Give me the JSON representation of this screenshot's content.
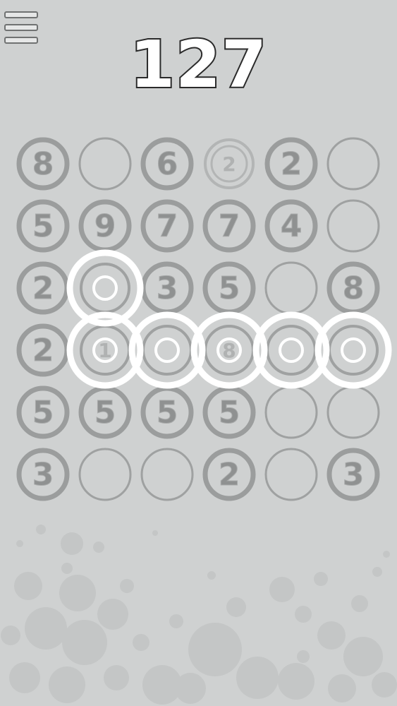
{
  "score": "127",
  "menu": {
    "icon": "hamburger-menu-icon"
  },
  "colors": {
    "background": "#cfd1d1",
    "ring_thick": "#9b9d9d",
    "ring_thin": "#9fa1a1",
    "number": "#8f9191",
    "highlight": "#ffffff"
  },
  "board": {
    "rows": [
      [
        {
          "v": "8",
          "state": "filled"
        },
        {
          "v": "",
          "state": "empty"
        },
        {
          "v": "6",
          "state": "filled"
        },
        {
          "v": "2",
          "state": "faded"
        },
        {
          "v": "2",
          "state": "filled"
        },
        {
          "v": "",
          "state": "empty"
        }
      ],
      [
        {
          "v": "5",
          "state": "filled"
        },
        {
          "v": "9",
          "state": "filled"
        },
        {
          "v": "7",
          "state": "filled"
        },
        {
          "v": "7",
          "state": "filled"
        },
        {
          "v": "4",
          "state": "filled"
        },
        {
          "v": "",
          "state": "empty"
        }
      ],
      [
        {
          "v": "2",
          "state": "filled"
        },
        {
          "v": "",
          "state": "selected"
        },
        {
          "v": "3",
          "state": "filled"
        },
        {
          "v": "5",
          "state": "filled"
        },
        {
          "v": "",
          "state": "empty"
        },
        {
          "v": "8",
          "state": "filled"
        }
      ],
      [
        {
          "v": "2",
          "state": "filled"
        },
        {
          "v": "1",
          "state": "selected"
        },
        {
          "v": "",
          "state": "selected"
        },
        {
          "v": "8",
          "state": "selected"
        },
        {
          "v": "",
          "state": "selected"
        },
        {
          "v": "",
          "state": "selected"
        }
      ],
      [
        {
          "v": "5",
          "state": "filled"
        },
        {
          "v": "5",
          "state": "filled"
        },
        {
          "v": "5",
          "state": "filled"
        },
        {
          "v": "5",
          "state": "filled"
        },
        {
          "v": "",
          "state": "empty"
        },
        {
          "v": "",
          "state": "empty"
        }
      ],
      [
        {
          "v": "3",
          "state": "filled"
        },
        {
          "v": "",
          "state": "empty"
        },
        {
          "v": "",
          "state": "empty"
        },
        {
          "v": "2",
          "state": "filled"
        },
        {
          "v": "",
          "state": "empty"
        },
        {
          "v": "3",
          "state": "filled"
        }
      ]
    ]
  }
}
